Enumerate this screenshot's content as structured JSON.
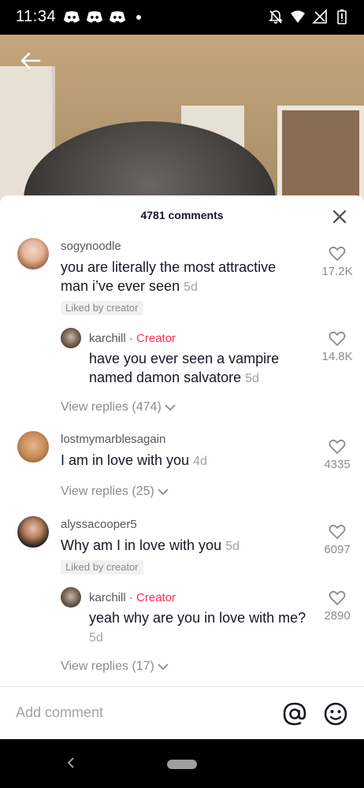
{
  "status_bar": {
    "time": "11:34",
    "left_icons": [
      "discord-icon",
      "discord-icon",
      "discord-icon",
      "notification-dot"
    ],
    "right_icons": [
      "mute-icon",
      "wifi-icon",
      "signal-icon",
      "battery-icon"
    ]
  },
  "header": {
    "comments_count": "4781 comments"
  },
  "comments": [
    {
      "username": "sogynoodle",
      "text": "you are literally the most attractive man i’ve ever seen",
      "time": "5d",
      "liked_by_creator": "Liked by creator",
      "likes": "17.2K",
      "reply": {
        "username": "karchill",
        "separator": " · ",
        "creator_label": "Creator",
        "text": "have you ever seen a vampire named damon salvatore",
        "time": "5d",
        "likes": "14.8K"
      },
      "view_replies": "View replies (474)"
    },
    {
      "username": "lostmymarblesagain",
      "text": "I am in love with you",
      "time": "4d",
      "likes": "4335",
      "view_replies": "View replies (25)"
    },
    {
      "username": "alyssacooper5",
      "text": "Why am I in love with you",
      "time": "5d",
      "liked_by_creator": "Liked by creator",
      "likes": "6097",
      "reply": {
        "username": "karchill",
        "separator": " · ",
        "creator_label": "Creator",
        "text": "yeah why are you in love with me?",
        "time": "5d",
        "likes": "2890"
      },
      "view_replies": "View replies (17)"
    }
  ],
  "input": {
    "placeholder": "Add comment"
  },
  "colors": {
    "creator_accent": "#fe2c55",
    "text_primary": "#161823",
    "text_secondary": "#8a8b91"
  }
}
